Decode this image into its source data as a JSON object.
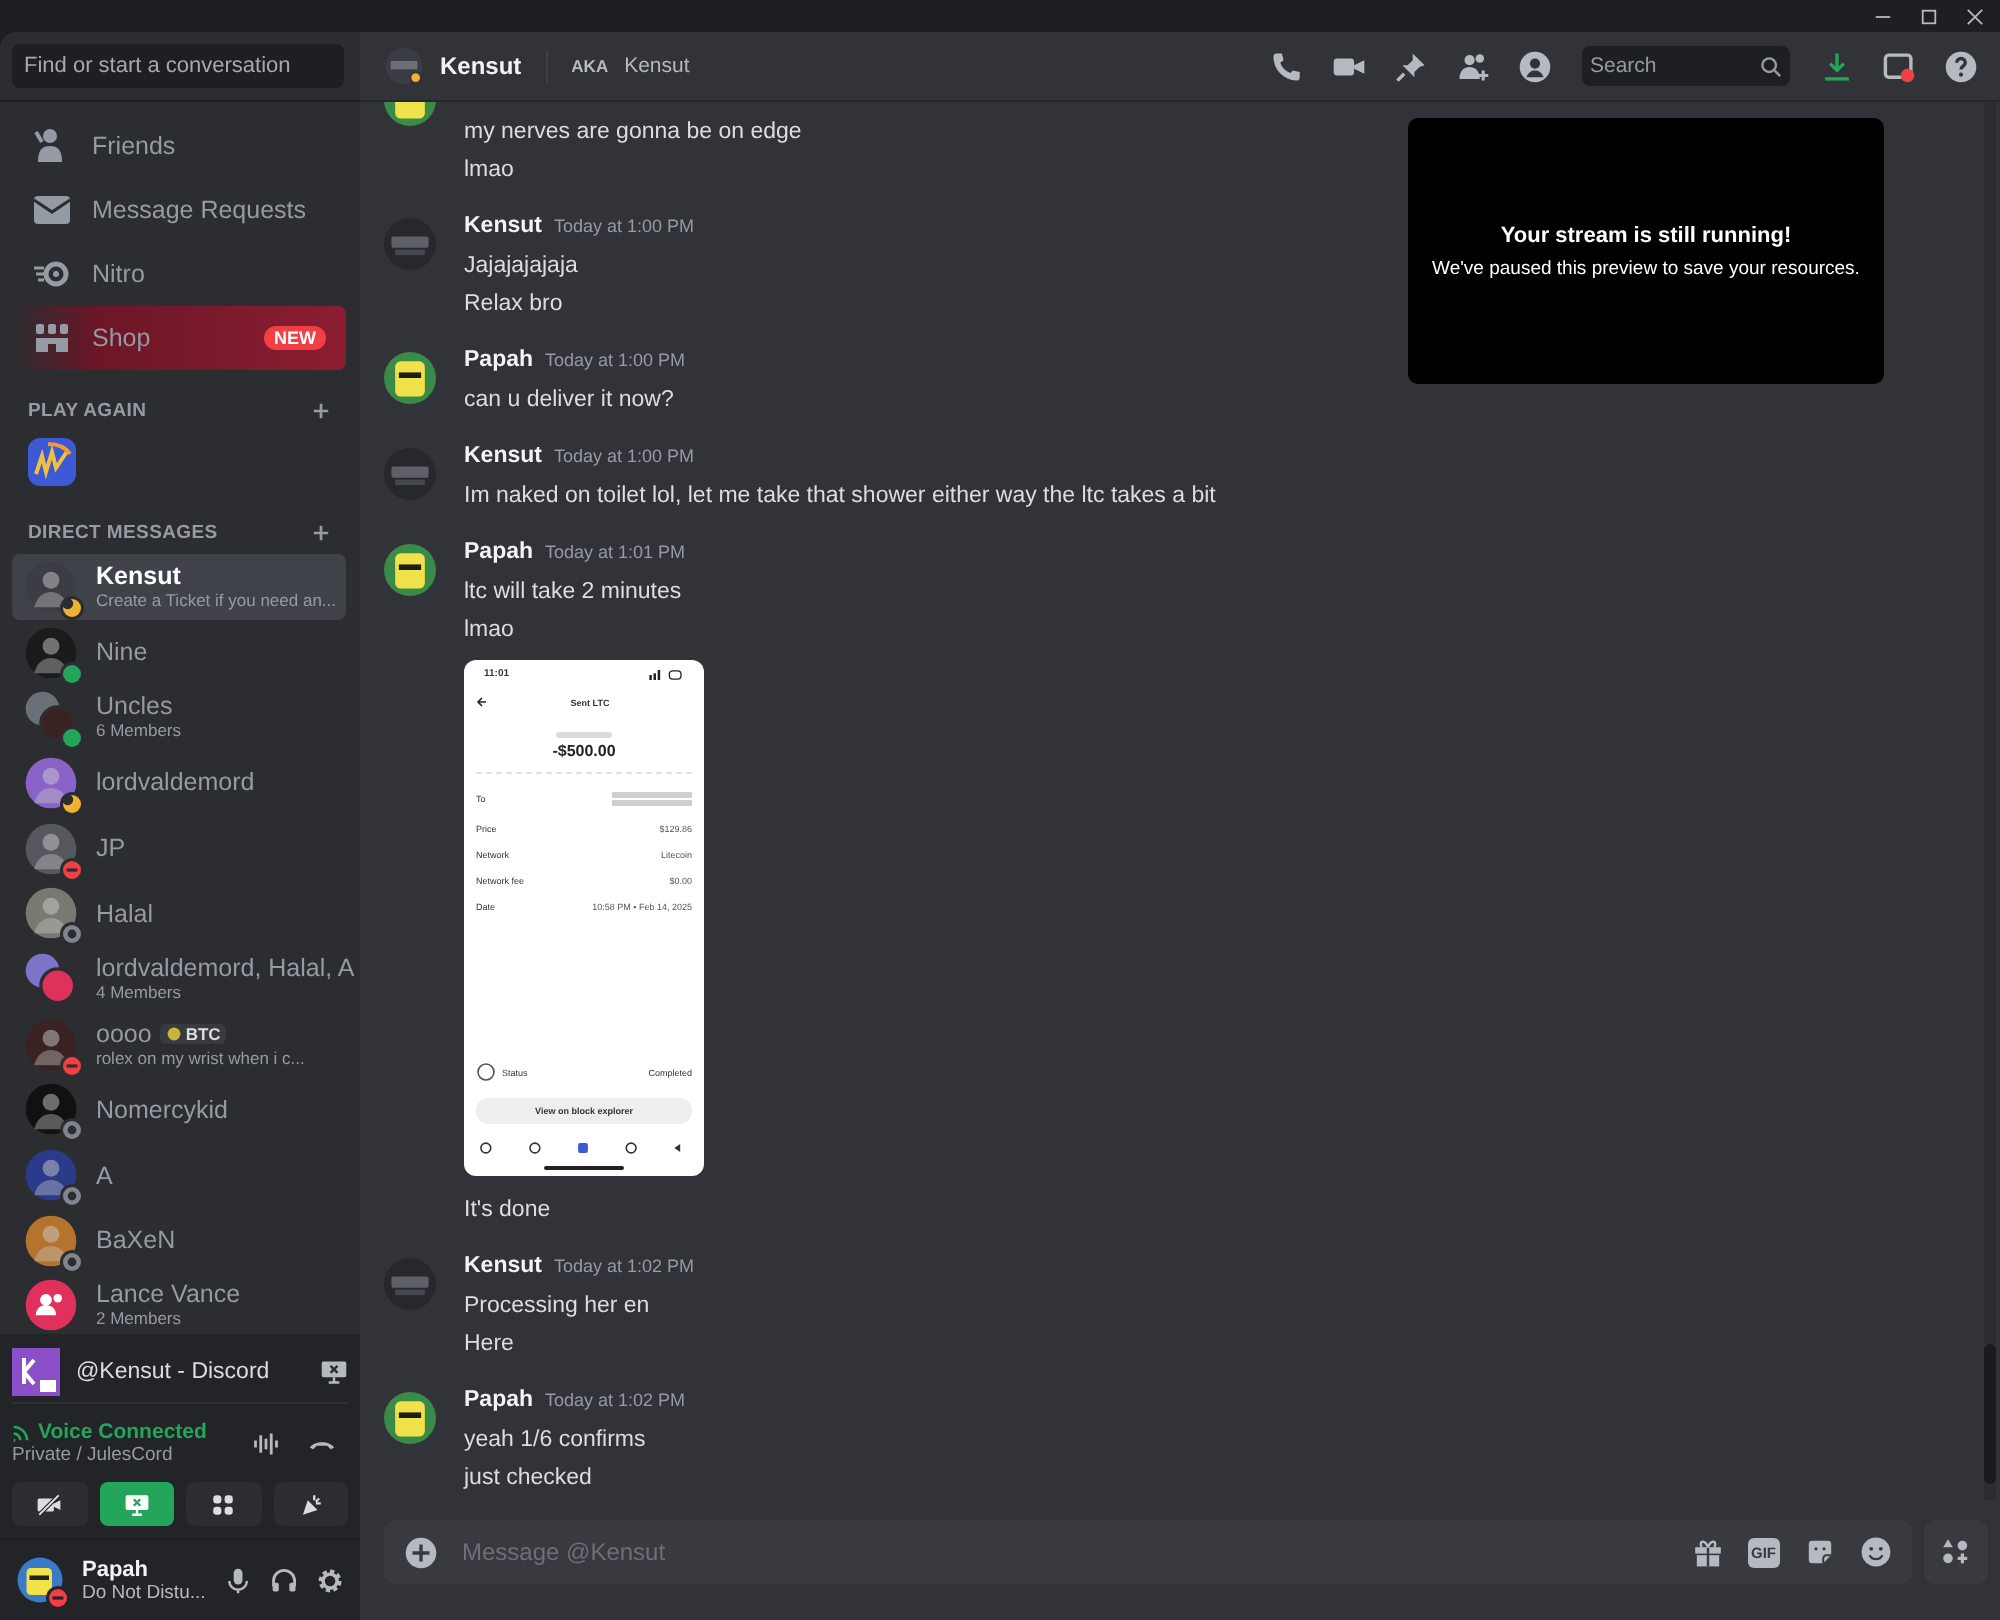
{
  "sidebar": {
    "search_placeholder": "Find or start a conversation",
    "nav": [
      {
        "label": "Friends",
        "kind": "friends"
      },
      {
        "label": "Message Requests",
        "kind": "requests"
      },
      {
        "label": "Nitro",
        "kind": "nitro"
      },
      {
        "label": "Shop",
        "kind": "shop",
        "badge": "NEW"
      }
    ],
    "play_again_title": "PLAY AGAIN",
    "dm_title": "DIRECT MESSAGES",
    "dms": [
      {
        "name": "Kensut",
        "subtitle": "Create a Ticket if you need an...",
        "kind": "user",
        "status": {
          "kind": "idle",
          "color": "#f0b232"
        },
        "selected": true
      },
      {
        "name": "Nine",
        "kind": "user",
        "status": {
          "kind": "online",
          "color": "#23a55a"
        },
        "selected": false
      },
      {
        "name": "Uncles",
        "subtitle": "6 Members",
        "kind": "group",
        "status": {
          "kind": "online",
          "color": "#23a55a"
        },
        "selected": false
      },
      {
        "name": "lordvaldemord",
        "kind": "user",
        "status": {
          "kind": "idle",
          "color": "#f0b232"
        },
        "selected": false
      },
      {
        "name": "JP",
        "kind": "user",
        "status": {
          "kind": "dnd",
          "color": "#f23f43"
        },
        "selected": false
      },
      {
        "name": "Halal",
        "kind": "user",
        "status": {
          "kind": "offline",
          "color": "#80848e"
        },
        "selected": false
      },
      {
        "name": "lordvaldemord, Halal, A",
        "subtitle": "4 Members",
        "kind": "group",
        "selected": false
      },
      {
        "name": "oooo",
        "tag": "BTC",
        "subtitle": "rolex on my wrist when i c...",
        "kind": "user",
        "status": {
          "kind": "dnd",
          "color": "#f23f43"
        },
        "selected": false
      },
      {
        "name": "Nomercykid",
        "kind": "user",
        "status": {
          "kind": "offline",
          "color": "#80848e"
        },
        "selected": false
      },
      {
        "name": "A",
        "kind": "user",
        "status": {
          "kind": "offline",
          "color": "#80848e"
        },
        "selected": false
      },
      {
        "name": "BaXeN",
        "kind": "user",
        "status": {
          "kind": "offline",
          "color": "#80848e"
        },
        "selected": false
      },
      {
        "name": "Lance Vance",
        "subtitle": "2 Members",
        "kind": "group_icon",
        "selected": false
      }
    ],
    "stream": {
      "title": "@Kensut - Discord"
    },
    "voice": {
      "status": "Voice Connected",
      "channel": "Private / JulesCord",
      "buttons": [
        {
          "kind": "camera",
          "selected": false
        },
        {
          "kind": "screen",
          "selected": true
        },
        {
          "kind": "activity",
          "selected": false
        },
        {
          "kind": "soundboard",
          "selected": false
        }
      ]
    },
    "user": {
      "name": "Papah",
      "status_text": "Do Not Distu...",
      "status": {
        "kind": "dnd",
        "color": "#f23f43"
      }
    }
  },
  "header": {
    "name": "Kensut",
    "aka_label": "AKA",
    "aka": "Kensut",
    "search_placeholder": "Search"
  },
  "stream_notice": {
    "title": "Your stream is still running!",
    "text": "We've paused this preview to save your resources."
  },
  "messages": [
    {
      "kind": "yellow",
      "lines": [
        "my nerves are gonna be on edge",
        "lmao"
      ]
    },
    {
      "kind": "dark",
      "author": "Kensut",
      "time": "Today at 1:00 PM",
      "lines": [
        "Jajajajajaja",
        "Relax bro"
      ]
    },
    {
      "kind": "yellow",
      "author": "Papah",
      "time": "Today at 1:00 PM",
      "lines": [
        "can u deliver it now?"
      ]
    },
    {
      "kind": "dark",
      "author": "Kensut",
      "time": "Today at 1:00 PM",
      "lines": [
        "Im naked on toilet lol, let me take that shower either way the ltc takes a bit"
      ]
    },
    {
      "kind": "yellow",
      "author": "Papah",
      "time": "Today at 1:01 PM",
      "lines": [
        "ltc will take 2 minutes",
        "lmao"
      ],
      "attachment": {
        "clock": "11:01",
        "title": "Sent LTC",
        "amount": "-$500.00",
        "rows": [
          {
            "label": "To"
          },
          {
            "label": "Price",
            "value": "$129.86"
          },
          {
            "label": "Network",
            "value": "Litecoin"
          },
          {
            "label": "Network fee",
            "value": "$0.00"
          },
          {
            "label": "Date",
            "value": "10:58 PM • Feb 14, 2025"
          }
        ],
        "status_label": "Status",
        "status_value": "Completed",
        "button": "View on block explorer"
      },
      "after_lines": [
        "It's done"
      ]
    },
    {
      "kind": "dark",
      "author": "Kensut",
      "time": "Today at 1:02 PM",
      "lines": [
        "Processing her en",
        "Here"
      ]
    },
    {
      "kind": "yellow",
      "author": "Papah",
      "time": "Today at 1:02 PM",
      "lines": [
        "yeah 1/6 confirms",
        "just checked"
      ]
    }
  ],
  "composer": {
    "placeholder": "Message @Kensut",
    "gif_label": "GIF"
  }
}
